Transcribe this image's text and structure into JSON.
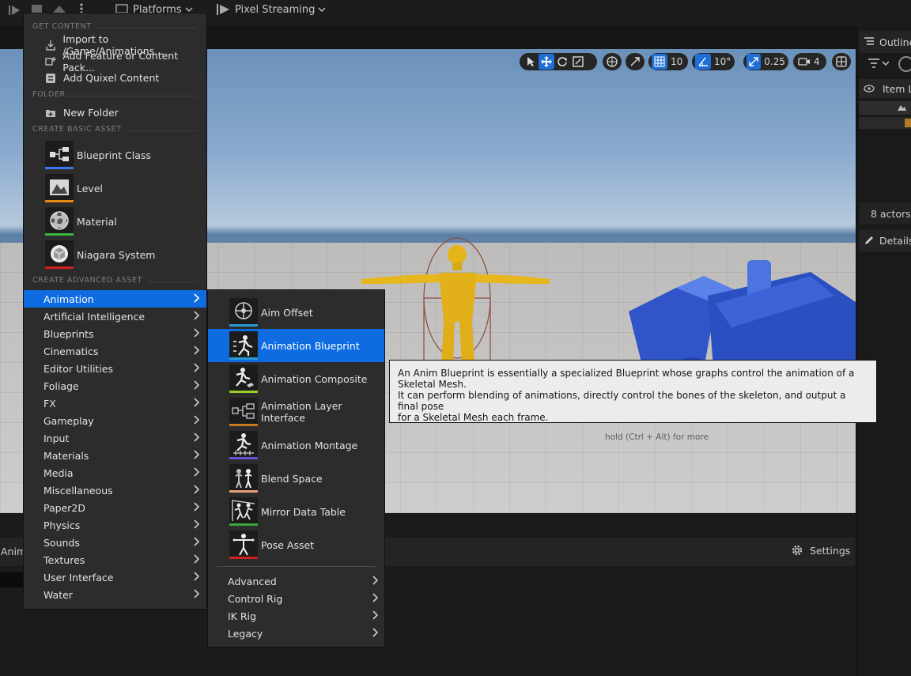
{
  "toolbar": {
    "platforms": "Platforms",
    "pixel_streaming": "Pixel Streaming"
  },
  "viewport_controls": {
    "grid_snap": "10",
    "rotation_snap": "10°",
    "scale_snap": "0.25",
    "camera_speed": "4"
  },
  "outliner": {
    "title": "Outliner",
    "column": "Item L",
    "actor_count": "8 actors"
  },
  "details": {
    "title": "Details"
  },
  "bottom_panel": {
    "tab_label": "Anim",
    "settings_label": "Settings"
  },
  "main_menu": {
    "get_content_header": "GET CONTENT",
    "import_label": "Import to /Game/Animations...",
    "add_feature_label": "Add Feature or Content Pack...",
    "add_quixel_label": "Add Quixel Content",
    "folder_header": "FOLDER",
    "new_folder_label": "New Folder",
    "basic_header": "CREATE BASIC ASSET",
    "basic_assets": [
      {
        "label": "Blueprint Class",
        "color": "#3a7af0"
      },
      {
        "label": "Level",
        "color": "#e88a12"
      },
      {
        "label": "Material",
        "color": "#36b93a"
      },
      {
        "label": "Niagara System",
        "color": "#d2201f"
      }
    ],
    "advanced_header": "CREATE ADVANCED ASSET",
    "categories": [
      "Animation",
      "Artificial Intelligence",
      "Blueprints",
      "Cinematics",
      "Editor Utilities",
      "Foliage",
      "FX",
      "Gameplay",
      "Input",
      "Materials",
      "Media",
      "Miscellaneous",
      "Paper2D",
      "Physics",
      "Sounds",
      "Textures",
      "User Interface",
      "Water"
    ],
    "selected_category": "Animation"
  },
  "animation_submenu": {
    "items": [
      {
        "label": "Aim Offset",
        "color": "#2a9ad8"
      },
      {
        "label": "Animation Blueprint",
        "color": "#2a9ad8"
      },
      {
        "label": "Animation Composite",
        "color": "#9ccc2a"
      },
      {
        "label": "Animation Layer Interface",
        "color": "#c9781e"
      },
      {
        "label": "Animation Montage",
        "color": "#6a52d8"
      },
      {
        "label": "Blend Space",
        "color": "#e8a07a"
      },
      {
        "label": "Mirror Data Table",
        "color": "#3aa83a"
      },
      {
        "label": "Pose Asset",
        "color": "#d2201f"
      }
    ],
    "more": [
      "Advanced",
      "Control Rig",
      "IK Rig",
      "Legacy"
    ],
    "selected": "Animation Blueprint"
  },
  "tooltip": {
    "line1": "An Anim Blueprint is essentially a specialized Blueprint whose graphs control the animation of a Skeletal Mesh.",
    "line2": "It can perform blending of animations, directly control the bones of the skeleton, and output a final pose",
    "line3": "for a Skeletal Mesh each frame.",
    "hint": "hold (Ctrl + Alt) for more"
  }
}
